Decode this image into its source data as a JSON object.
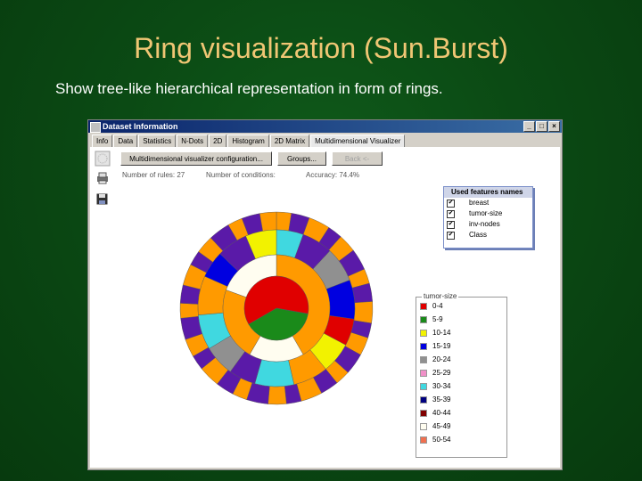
{
  "slide": {
    "title": "Ring visualization (Sun.Burst)",
    "subtitle": "Show tree-like hierarchical representation in form of rings."
  },
  "window": {
    "title": "Dataset Information",
    "controls": [
      "_",
      "□",
      "×"
    ],
    "tabs": [
      "Info",
      "Data",
      "Statistics",
      "N-Dots",
      "2D",
      "Histogram",
      "2D Matrix",
      "Multidimensional Visualizer"
    ],
    "active_tab": "Multidimensional Visualizer"
  },
  "toolbar": {
    "config_button": "Multidimensional visualizer configuration...",
    "groups_button": "Groups...",
    "back_button": "Back <-"
  },
  "stats": {
    "rules": "Number of rules: 27",
    "conditions": "Number of conditions:",
    "accuracy": "Accuracy: 74.4%"
  },
  "features": {
    "title": "Used features names",
    "items": [
      "breast",
      "tumor-size",
      "inv-nodes",
      "Class"
    ]
  },
  "legend": {
    "title": "tumor-size",
    "items": [
      {
        "label": "0-4",
        "color": "#e00000"
      },
      {
        "label": "5-9",
        "color": "#1a8a1a"
      },
      {
        "label": "10-14",
        "color": "#f2f200"
      },
      {
        "label": "15-19",
        "color": "#0000e0"
      },
      {
        "label": "20-24",
        "color": "#909090"
      },
      {
        "label": "25-29",
        "color": "#f090c8"
      },
      {
        "label": "30-34",
        "color": "#40d8e0"
      },
      {
        "label": "35-39",
        "color": "#000080"
      },
      {
        "label": "40-44",
        "color": "#800000"
      },
      {
        "label": "45-49",
        "color": "#fffdf0"
      },
      {
        "label": "50-54",
        "color": "#f07050"
      }
    ]
  },
  "colors": {
    "orange": "#ff9a00",
    "purple": "#5a1aa8",
    "cream": "#fffdf0"
  }
}
